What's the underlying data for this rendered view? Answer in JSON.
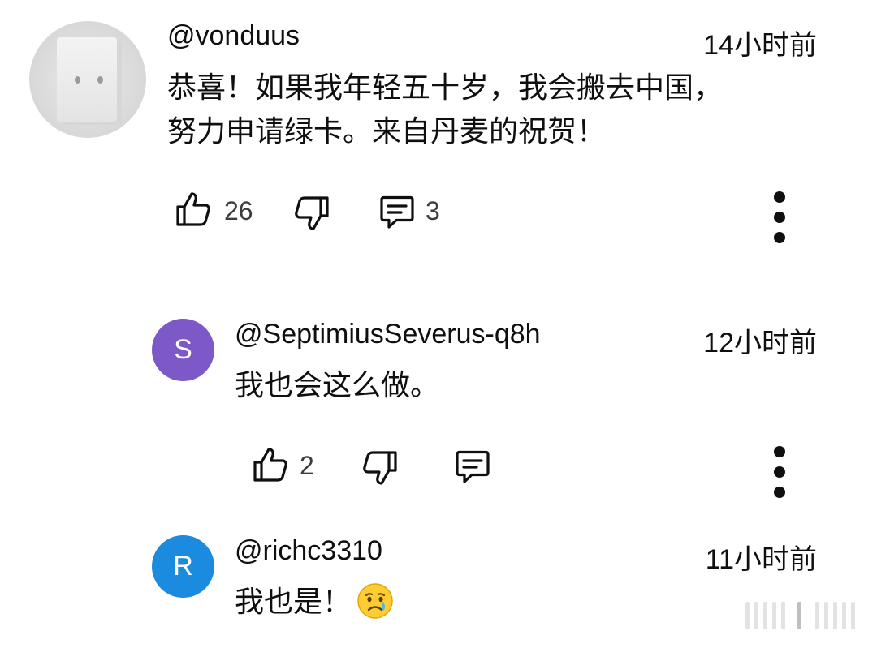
{
  "comments": [
    {
      "username": "@vonduus",
      "time": "14小时前",
      "text_line1": "恭喜！如果我年轻五十岁，我会搬去中国，",
      "text_line2": "努力申请绿卡。来自丹麦的祝贺！",
      "likes": "26",
      "replies": "3",
      "avatar": "photo"
    },
    {
      "username": "@SeptimiusSeverus-q8h",
      "time": "12小时前",
      "text": "我也会这么做。",
      "likes": "2",
      "avatar_letter": "S",
      "avatar_color": "#7c59c7"
    },
    {
      "username": "@richc3310",
      "time": "11小时前",
      "text": "我也是！",
      "emoji": "crying-face-icon",
      "avatar_letter": "R",
      "avatar_color": "#1b8be0"
    }
  ],
  "icons": {
    "like": "thumbs-up-icon",
    "dislike": "thumbs-down-icon",
    "reply": "reply-comment-icon",
    "more": "more-vertical-icon"
  }
}
